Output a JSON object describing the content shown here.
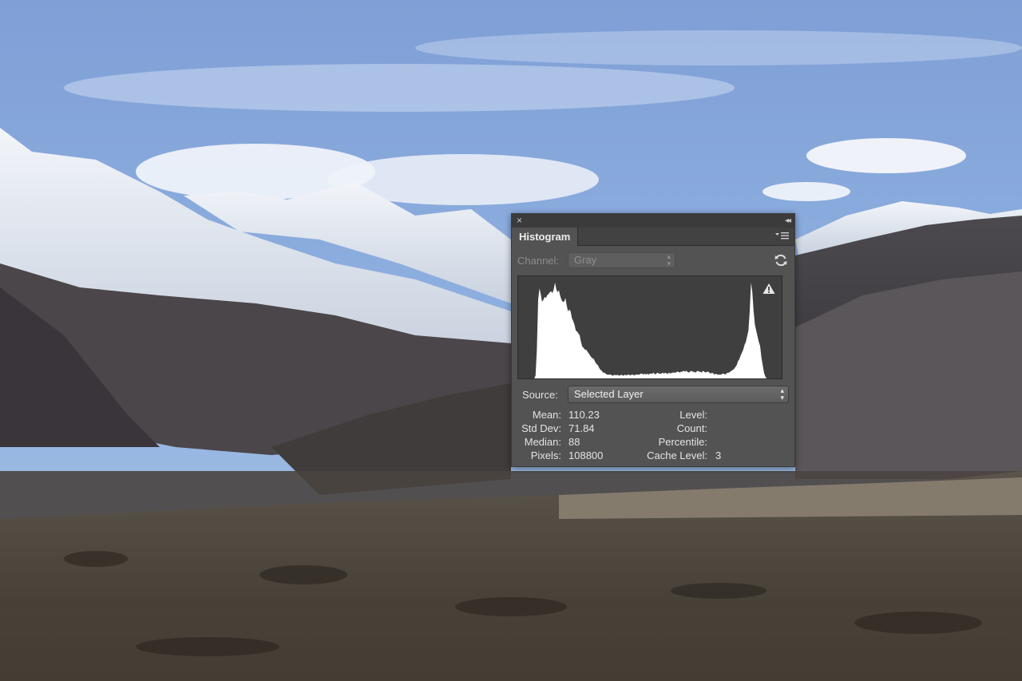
{
  "panel": {
    "close_glyph": "×",
    "collapse_glyph": "◂◂",
    "tab_label": "Histogram",
    "channel_label": "Channel:",
    "channel_value": "Gray",
    "source_label": "Source:",
    "source_value": "Selected Layer",
    "stats_left": [
      {
        "label": "Mean:",
        "value": "110.23"
      },
      {
        "label": "Std Dev:",
        "value": "71.84"
      },
      {
        "label": "Median:",
        "value": "88"
      },
      {
        "label": "Pixels:",
        "value": "108800"
      }
    ],
    "stats_right": [
      {
        "label": "Level:",
        "value": ""
      },
      {
        "label": "Count:",
        "value": ""
      },
      {
        "label": "Percentile:",
        "value": ""
      },
      {
        "label": "Cache Level:",
        "value": "3"
      }
    ],
    "histogram_levels": [
      0,
      0,
      0,
      0,
      0,
      0,
      3,
      30,
      82,
      94,
      88,
      80,
      82,
      85,
      84,
      87,
      88,
      90,
      91,
      89,
      93,
      100,
      93,
      90,
      92,
      86,
      82,
      80,
      80,
      84,
      76,
      70,
      72,
      70,
      63,
      60,
      56,
      50,
      49,
      47,
      45,
      38,
      33,
      32,
      30,
      30,
      28,
      26,
      24,
      22,
      21,
      20,
      17,
      15,
      14,
      11,
      9,
      8,
      6,
      6,
      5,
      4,
      4,
      4,
      4,
      3,
      3,
      4,
      3,
      4,
      3,
      3,
      4,
      3,
      3,
      4,
      3,
      4,
      4,
      3,
      4,
      4,
      3,
      4,
      4,
      4,
      4,
      5,
      5,
      4,
      5,
      4,
      5,
      4,
      5,
      5,
      5,
      6,
      4,
      5,
      6,
      5,
      5,
      5,
      6,
      5,
      6,
      5,
      5,
      6,
      5,
      6,
      6,
      6,
      6,
      7,
      7,
      6,
      7,
      7,
      8,
      7,
      8,
      7,
      6,
      7,
      8,
      7,
      7,
      6,
      7,
      8,
      7,
      7,
      6,
      8,
      7,
      6,
      7,
      7,
      6,
      5,
      6,
      5,
      4,
      5,
      4,
      4,
      4,
      4,
      5,
      5,
      4,
      5,
      6,
      6,
      7,
      8,
      9,
      10,
      12,
      14,
      18,
      20,
      24,
      27,
      30,
      35,
      38,
      44,
      50,
      70,
      100,
      90,
      70,
      56,
      50,
      44,
      38,
      34,
      22,
      14,
      6,
      2,
      0,
      0,
      0,
      0
    ]
  },
  "colors": {
    "panel_bg": "#535353",
    "histogram_fill": "#ffffff",
    "histogram_bg": "#3f3f3f"
  },
  "icons": {
    "close": "close-icon",
    "collapse": "collapse-icon",
    "panel_menu": "panel-menu-icon",
    "refresh": "refresh-icon",
    "warning": "warning-icon"
  }
}
